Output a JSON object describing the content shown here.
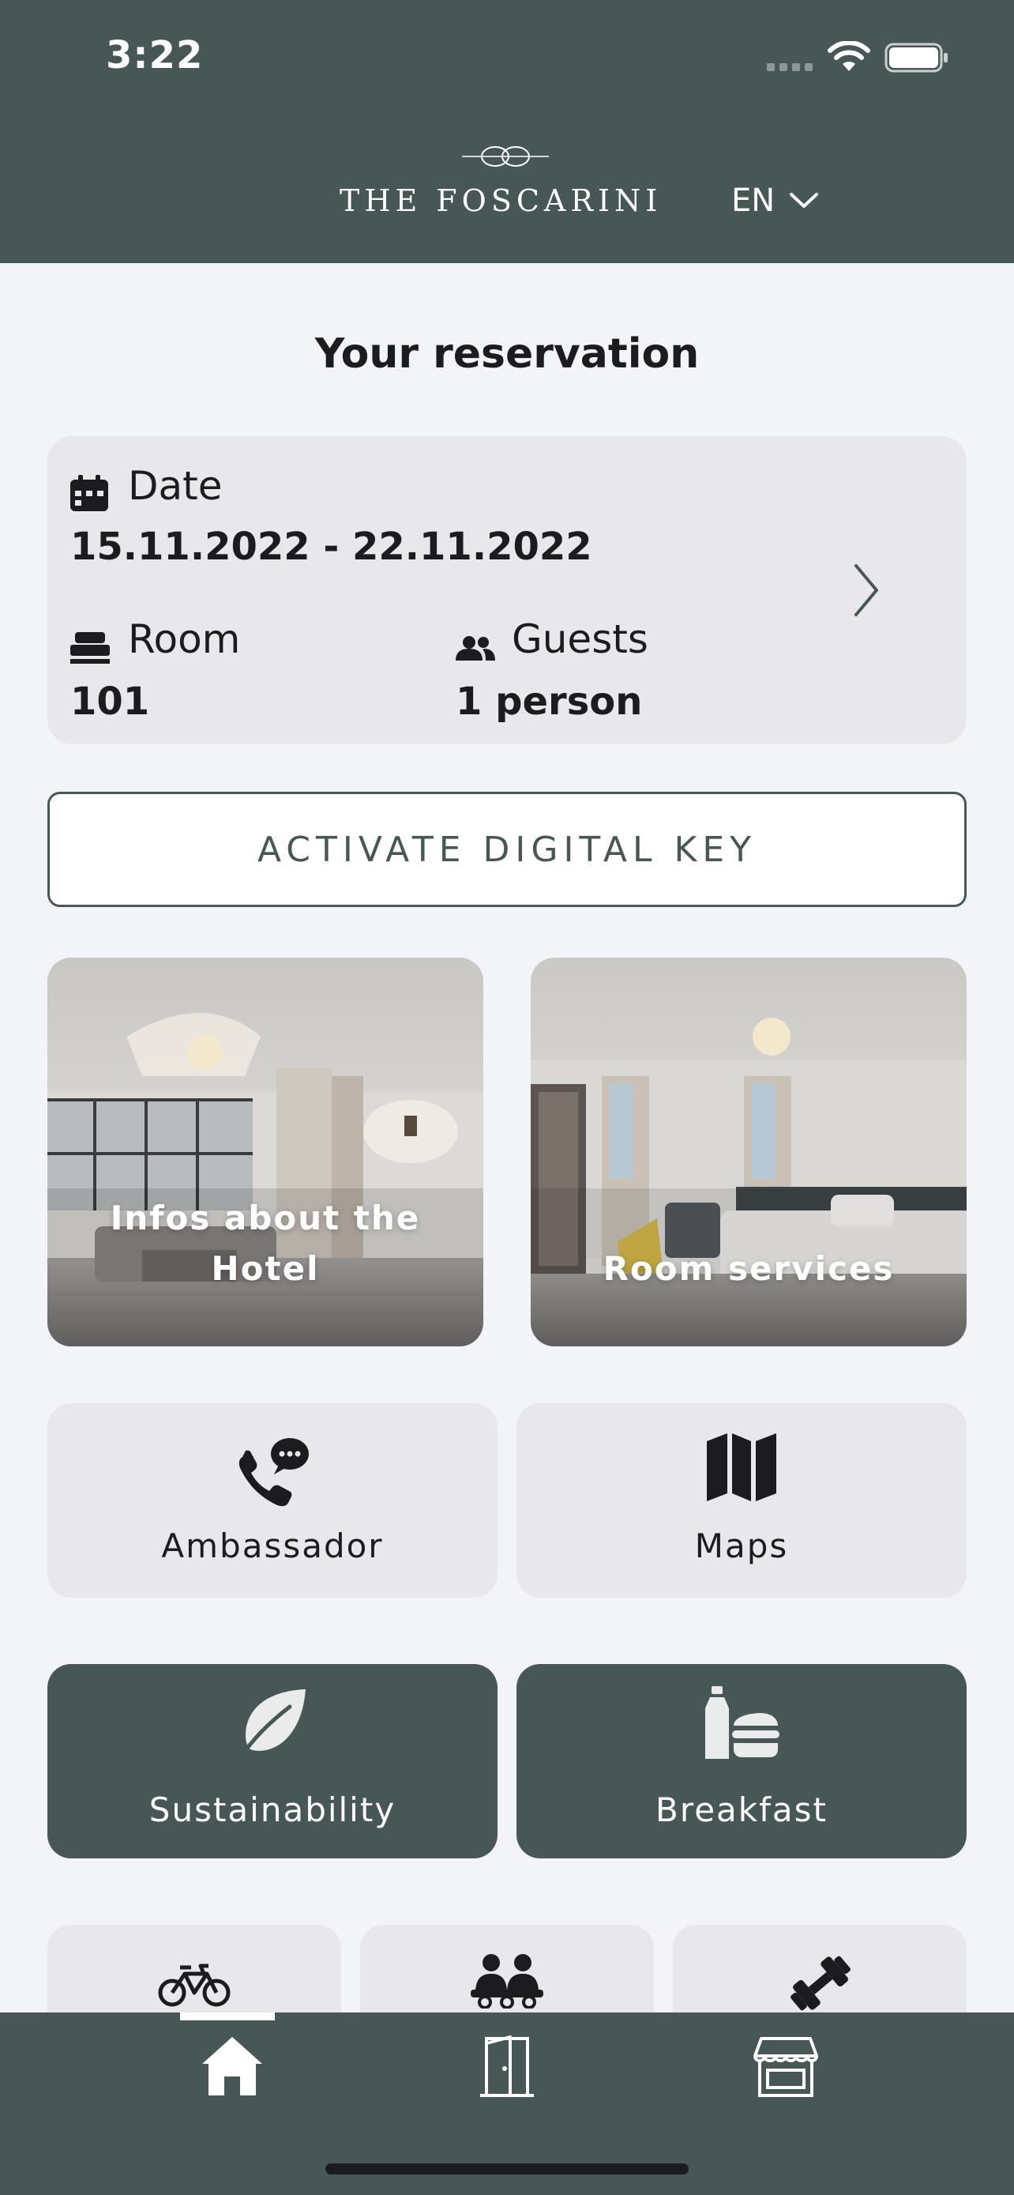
{
  "status_bar": {
    "time": "3:22"
  },
  "header": {
    "brand": "THE FOSCARINI",
    "language": "EN"
  },
  "reservation": {
    "title": "Your reservation",
    "date_label": "Date",
    "date_value": "15.11.2022 - 22.11.2022",
    "room_label": "Room",
    "room_value": "101",
    "guests_label": "Guests",
    "guests_value": "1 person"
  },
  "digital_key": {
    "label": "ACTIVATE DIGITAL KEY"
  },
  "photo_tiles": [
    {
      "label_line1": "Infos about the",
      "label_line2": "Hotel"
    },
    {
      "label_line1": "Room services"
    }
  ],
  "tiles": [
    {
      "label": "Ambassador",
      "icon": "phone-chat-icon"
    },
    {
      "label": "Maps",
      "icon": "map-icon"
    },
    {
      "label": "Sustainability",
      "icon": "leaf-icon"
    },
    {
      "label": "Breakfast",
      "icon": "food-icon"
    }
  ],
  "small_tiles": [
    {
      "icon": "bicycle-icon"
    },
    {
      "icon": "people-icon"
    },
    {
      "icon": "dumbbell-icon"
    }
  ],
  "tab_bar": [
    {
      "icon": "home-icon",
      "active": true
    },
    {
      "icon": "door-icon",
      "active": false
    },
    {
      "icon": "store-icon",
      "active": false
    }
  ],
  "colors": {
    "brand": "#475755",
    "tile_light": "#e8e8ea",
    "background": "#f3f4f8"
  }
}
